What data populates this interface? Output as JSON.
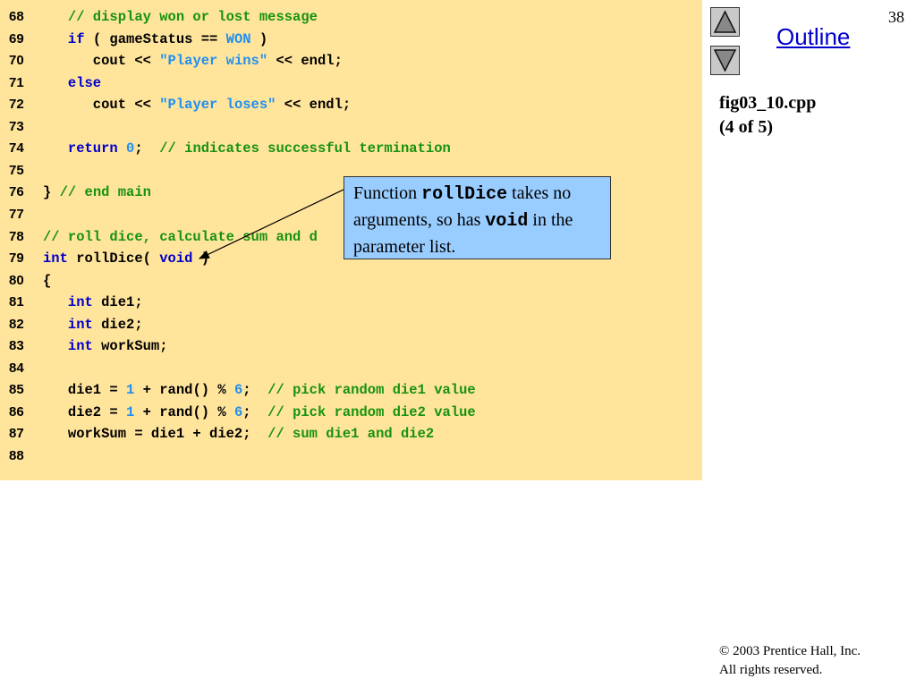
{
  "page_number": "38",
  "outline": {
    "title": "Outline",
    "up_icon": "triangle-up",
    "down_icon": "triangle-down"
  },
  "file": {
    "name": "fig03_10.cpp",
    "part": "(4 of 5)"
  },
  "code_lines": [
    {
      "num": "68",
      "segs": [
        [
          "plain",
          "   "
        ],
        [
          "com",
          "// display won or lost message"
        ]
      ]
    },
    {
      "num": "69",
      "segs": [
        [
          "plain",
          "   "
        ],
        [
          "kw",
          "if"
        ],
        [
          "plain",
          " ( gameStatus == "
        ],
        [
          "str",
          "WON"
        ],
        [
          "plain",
          " )"
        ]
      ]
    },
    {
      "num": "70",
      "segs": [
        [
          "plain",
          "      cout << "
        ],
        [
          "str",
          "\"Player wins\""
        ],
        [
          "plain",
          " << endl;"
        ]
      ]
    },
    {
      "num": "71",
      "segs": [
        [
          "plain",
          "   "
        ],
        [
          "kw",
          "else"
        ]
      ]
    },
    {
      "num": "72",
      "segs": [
        [
          "plain",
          "      cout << "
        ],
        [
          "str",
          "\"Player loses\""
        ],
        [
          "plain",
          " << endl;"
        ]
      ]
    },
    {
      "num": "73",
      "segs": []
    },
    {
      "num": "74",
      "segs": [
        [
          "plain",
          "   "
        ],
        [
          "kw",
          "return"
        ],
        [
          "plain",
          " "
        ],
        [
          "num",
          "0"
        ],
        [
          "plain",
          ";  "
        ],
        [
          "com",
          "// indicates successful termination"
        ]
      ]
    },
    {
      "num": "75",
      "segs": []
    },
    {
      "num": "76",
      "segs": [
        [
          "plain",
          "} "
        ],
        [
          "com",
          "// end main"
        ]
      ]
    },
    {
      "num": "77",
      "segs": []
    },
    {
      "num": "78",
      "segs": [
        [
          "com",
          "// roll dice, calculate sum and d"
        ]
      ]
    },
    {
      "num": "79",
      "segs": [
        [
          "kw",
          "int"
        ],
        [
          "plain",
          " rollDice( "
        ],
        [
          "kw",
          "void"
        ],
        [
          "plain",
          " )"
        ]
      ]
    },
    {
      "num": "80",
      "segs": [
        [
          "plain",
          "{"
        ]
      ]
    },
    {
      "num": "81",
      "segs": [
        [
          "plain",
          "   "
        ],
        [
          "kw",
          "int"
        ],
        [
          "plain",
          " die1;"
        ]
      ]
    },
    {
      "num": "82",
      "segs": [
        [
          "plain",
          "   "
        ],
        [
          "kw",
          "int"
        ],
        [
          "plain",
          " die2;"
        ]
      ]
    },
    {
      "num": "83",
      "segs": [
        [
          "plain",
          "   "
        ],
        [
          "kw",
          "int"
        ],
        [
          "plain",
          " workSum;"
        ]
      ]
    },
    {
      "num": "84",
      "segs": []
    },
    {
      "num": "85",
      "segs": [
        [
          "plain",
          "   die1 = "
        ],
        [
          "num",
          "1"
        ],
        [
          "plain",
          " + rand() % "
        ],
        [
          "num",
          "6"
        ],
        [
          "plain",
          ";  "
        ],
        [
          "com",
          "// pick random die1 value"
        ]
      ]
    },
    {
      "num": "86",
      "segs": [
        [
          "plain",
          "   die2 = "
        ],
        [
          "num",
          "1"
        ],
        [
          "plain",
          " + rand() % "
        ],
        [
          "num",
          "6"
        ],
        [
          "plain",
          ";  "
        ],
        [
          "com",
          "// pick random die2 value"
        ]
      ]
    },
    {
      "num": "87",
      "segs": [
        [
          "plain",
          "   workSum = die1 + die2;  "
        ],
        [
          "com",
          "// sum die1 and die2"
        ]
      ]
    },
    {
      "num": "88",
      "segs": []
    }
  ],
  "callout": {
    "part1": "Function ",
    "code1": "rollDice",
    "part2": " takes no arguments, so has ",
    "code2": "void",
    "part3": " in the parameter list."
  },
  "copyright": {
    "symbol": "©",
    "line1": " 2003 Prentice Hall, Inc.",
    "line2": "All rights reserved."
  },
  "colors": {
    "panel_bg": "#ffe49c",
    "keyword": "#0000cc",
    "comment": "#16930e",
    "literal": "#1f8ff0",
    "callout_bg": "#99ccff"
  }
}
